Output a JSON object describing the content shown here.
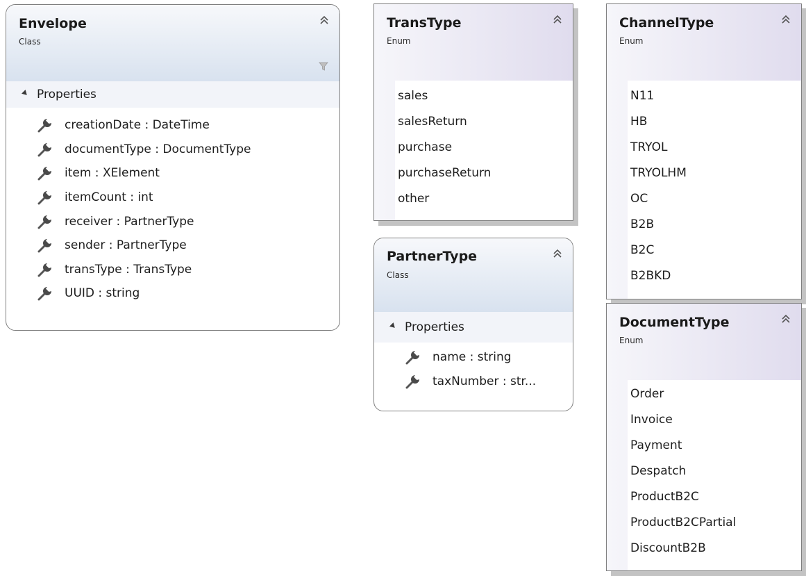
{
  "envelope": {
    "name": "Envelope",
    "kind": "Class",
    "section": "Properties",
    "properties": [
      "creationDate : DateTime",
      "documentType : DocumentType",
      "item : XElement",
      "itemCount : int",
      "receiver : PartnerType",
      "sender : PartnerType",
      "transType : TransType",
      "UUID : string"
    ]
  },
  "trans_type": {
    "name": "TransType",
    "kind": "Enum",
    "values": [
      "sales",
      "salesReturn",
      "purchase",
      "purchaseReturn",
      "other"
    ]
  },
  "partner_type": {
    "name": "PartnerType",
    "kind": "Class",
    "section": "Properties",
    "properties": [
      "name : string",
      "taxNumber : str..."
    ]
  },
  "channel_type": {
    "name": "ChannelType",
    "kind": "Enum",
    "values": [
      "N11",
      "HB",
      "TRYOL",
      "TRYOLHM",
      "OC",
      "B2B",
      "B2C",
      "B2BKD"
    ]
  },
  "document_type": {
    "name": "DocumentType",
    "kind": "Enum",
    "values": [
      "Order",
      "Invoice",
      "Payment",
      "Despatch",
      "ProductB2C",
      "ProductB2CPartial",
      "DiscountB2B"
    ]
  },
  "icons": {
    "collapse": "double-chevron-up-icon",
    "property": "wrench-icon",
    "filter": "funnel-icon"
  }
}
